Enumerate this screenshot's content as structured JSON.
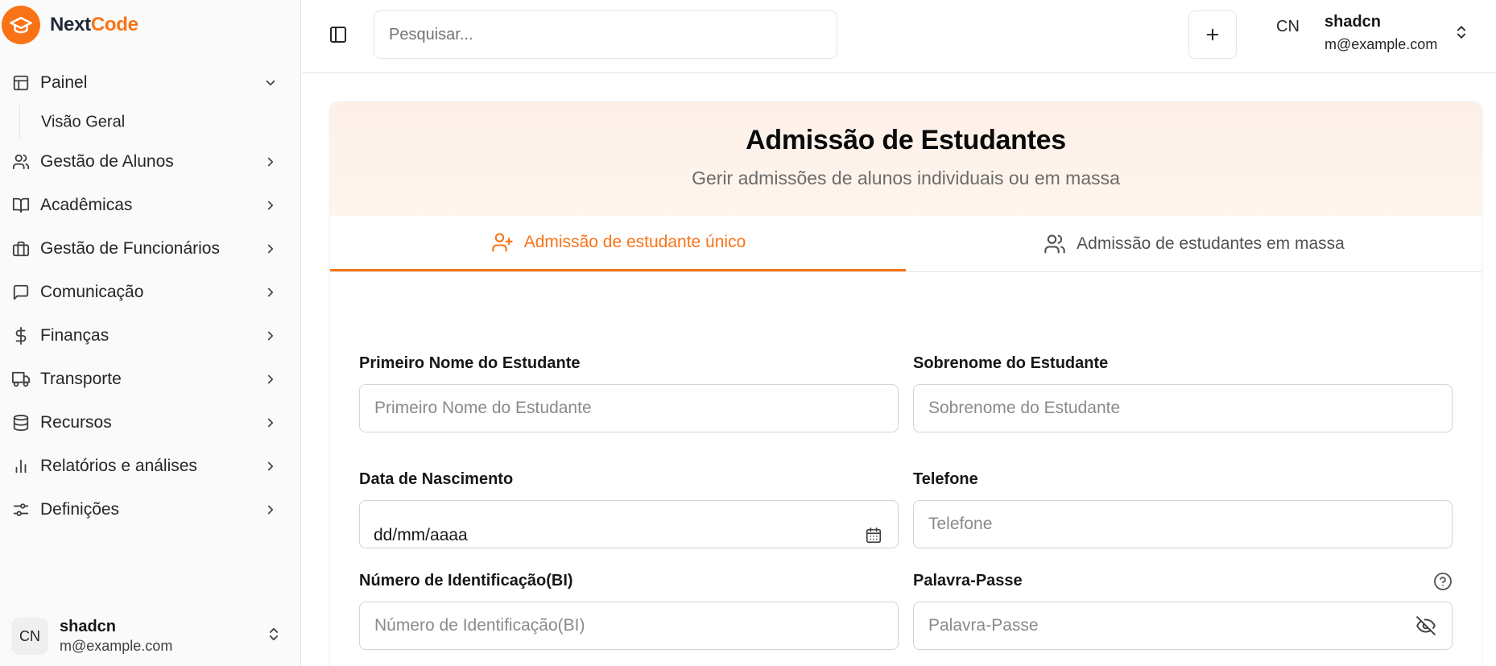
{
  "brand": {
    "name_part1": "Next",
    "name_part2": "Code",
    "color": "#f97316"
  },
  "sidebar": {
    "items": [
      {
        "label": "Painel",
        "icon": "layout-icon",
        "expanded": true,
        "sub": [
          {
            "label": "Visão Geral"
          }
        ]
      },
      {
        "label": "Gestão de Alunos",
        "icon": "users-icon"
      },
      {
        "label": "Acadêmicas",
        "icon": "book-icon"
      },
      {
        "label": "Gestão de Funcionários",
        "icon": "building-icon"
      },
      {
        "label": "Comunicação",
        "icon": "message-icon"
      },
      {
        "label": "Finanças",
        "icon": "dollar-icon"
      },
      {
        "label": "Transporte",
        "icon": "truck-icon"
      },
      {
        "label": "Recursos",
        "icon": "database-icon"
      },
      {
        "label": "Relatórios e análises",
        "icon": "bar-chart-icon"
      },
      {
        "label": "Definições",
        "icon": "settings-icon"
      }
    ],
    "user": {
      "initials": "CN",
      "name": "shadcn",
      "email": "m@example.com"
    }
  },
  "header": {
    "search_placeholder": "Pesquisar...",
    "initials": "CN",
    "user_name": "shadcn",
    "user_email": "m@example.com"
  },
  "card": {
    "title": "Admissão de Estudantes",
    "subtitle": "Gerir admissões de alunos individuais ou em massa",
    "tabs": [
      {
        "label": "Admissão de estudante único",
        "icon": "user-plus-icon",
        "active": true
      },
      {
        "label": "Admissão de estudantes em massa",
        "icon": "users-icon",
        "active": false
      }
    ]
  },
  "form": {
    "first_name": {
      "label": "Primeiro Nome do Estudante",
      "placeholder": "Primeiro Nome do Estudante"
    },
    "last_name": {
      "label": "Sobrenome do Estudante",
      "placeholder": "Sobrenome do Estudante"
    },
    "birth_date": {
      "label": "Data de Nascimento",
      "value": "dd/mm/aaaa"
    },
    "phone": {
      "label": "Telefone",
      "placeholder": "Telefone"
    },
    "id_number": {
      "label": "Número de Identificação(BI)",
      "placeholder": "Número de Identificação(BI)"
    },
    "password": {
      "label": "Palavra-Passe",
      "placeholder": "Palavra-Passe"
    }
  }
}
